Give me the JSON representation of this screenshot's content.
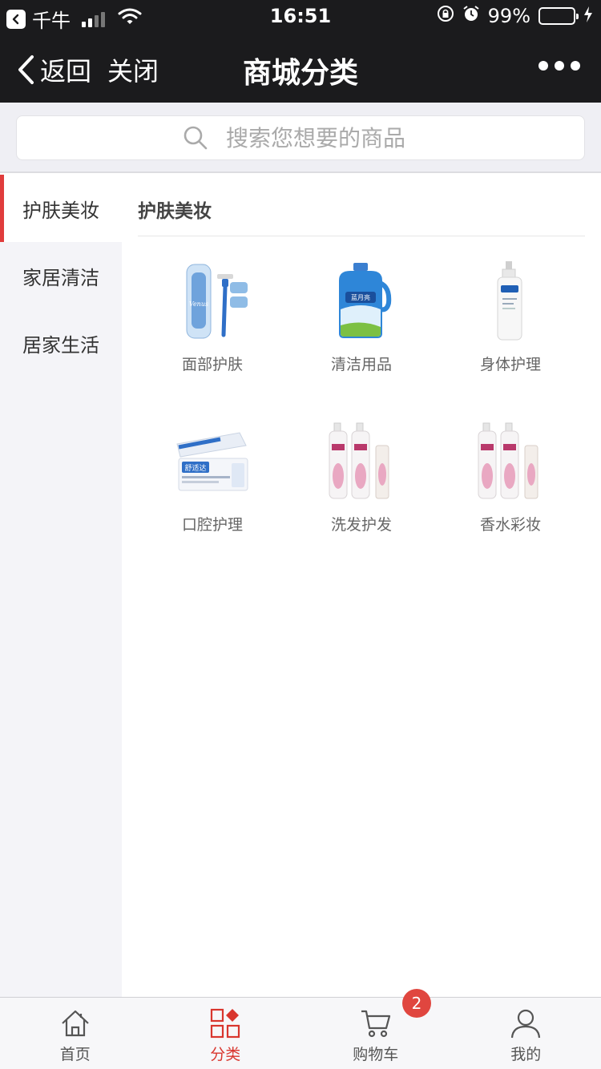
{
  "status": {
    "carrier": "千牛",
    "time": "16:51",
    "battery": "99%",
    "battery_level": 0.99
  },
  "nav": {
    "back_label": "返回",
    "close_label": "关闭",
    "title": "商城分类"
  },
  "search": {
    "placeholder": "搜索您想要的商品"
  },
  "sidebar": {
    "items": [
      {
        "label": "护肤美妆",
        "active": true
      },
      {
        "label": "家居清洁",
        "active": false
      },
      {
        "label": "居家生活",
        "active": false
      }
    ]
  },
  "main": {
    "section_title": "护肤美妆",
    "categories": [
      {
        "label": "面部护肤",
        "icon": "razor-product-image"
      },
      {
        "label": "清洁用品",
        "icon": "detergent-bottle-image"
      },
      {
        "label": "身体护理",
        "icon": "lotion-bottle-image"
      },
      {
        "label": "口腔护理",
        "icon": "toothpaste-image"
      },
      {
        "label": "洗发护发",
        "icon": "shampoo-bottles-image"
      },
      {
        "label": "香水彩妆",
        "icon": "shampoo-bottles-image"
      }
    ]
  },
  "tabbar": {
    "tabs": [
      {
        "label": "首页",
        "icon": "home-icon"
      },
      {
        "label": "分类",
        "icon": "category-icon",
        "active": true
      },
      {
        "label": "购物车",
        "icon": "cart-icon"
      },
      {
        "label": "我的",
        "icon": "user-icon"
      }
    ],
    "cart_badge": "2",
    "accent": "#d9362e"
  }
}
